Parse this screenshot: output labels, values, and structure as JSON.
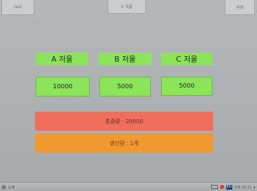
{
  "top_buttons": {
    "test_label": "test",
    "zero_label": "0 저울",
    "save_label": "저장"
  },
  "scales": [
    {
      "label": "A 저울",
      "value": "10000"
    },
    {
      "label": "B 저울",
      "value": "5000"
    },
    {
      "label": "C 저울",
      "value": "5000"
    }
  ],
  "total": {
    "text": "총중량 : 20000"
  },
  "production": {
    "text": "생산량 : 1개"
  },
  "taskbar": {
    "start_label": "시작",
    "lang_label": "EO",
    "tray_text": "오후 12:11"
  },
  "colors": {
    "scale_green": "#8ce45a",
    "total_red": "#ef6e5c",
    "production_orange": "#f09930",
    "background_gray": "#aeb2b4"
  },
  "icons": {
    "start": "windows-start-icon",
    "keyboard": "keyboard-icon",
    "flag": "flag-icon",
    "tray_arrow": "tray-arrow-icon"
  }
}
